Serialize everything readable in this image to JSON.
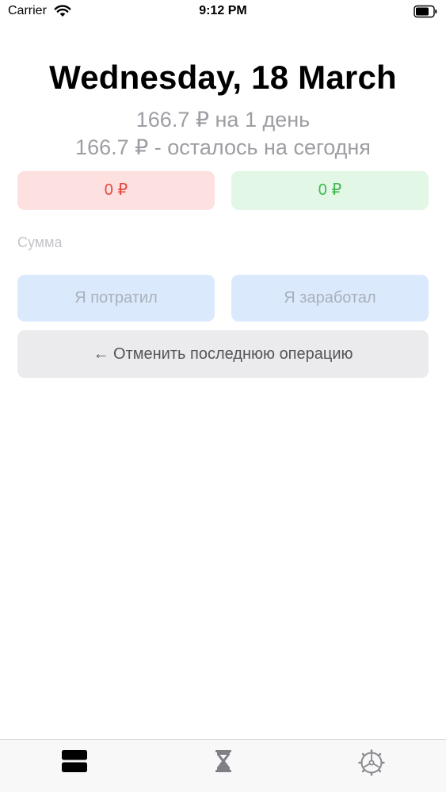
{
  "status_bar": {
    "carrier": "Carrier",
    "time": "9:12 PM",
    "icons": [
      "wifi-icon",
      "battery-icon"
    ]
  },
  "header": {
    "date": "Wednesday, 18 March",
    "daily_limit": "166.7 ₽ на 1 день",
    "remaining_today": "166.7 ₽ - осталось на сегодня"
  },
  "totals": {
    "spent": "0 ₽",
    "earned": "0 ₽"
  },
  "amount_input": {
    "value": "",
    "placeholder": "Сумма"
  },
  "actions": {
    "spent_label": "Я потратил",
    "earned_label": "Я заработал",
    "undo_label": "← Отменить последнюю операцию"
  },
  "tab_bar": {
    "tabs": [
      {
        "icon": "list-icon",
        "selected": true
      },
      {
        "icon": "hourglass-icon",
        "selected": false
      },
      {
        "icon": "settings-icon",
        "selected": false
      }
    ]
  },
  "colors": {
    "spent_text": "#e5493d",
    "spent_bg": "#fde0e0",
    "earned_text": "#3fb750",
    "earned_bg": "#e3f7e6",
    "action_bg": "#dbe9fc",
    "subtitle_gray": "#9d9da3"
  }
}
